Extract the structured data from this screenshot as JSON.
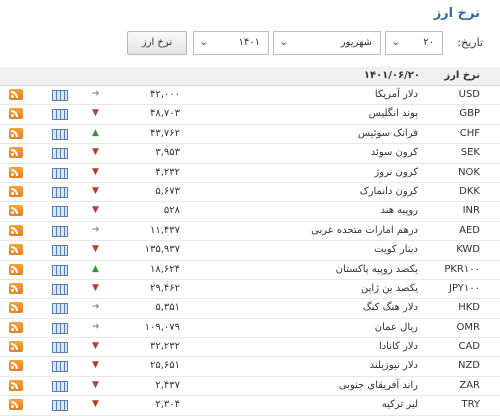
{
  "header": {
    "title": "نرخ ارز"
  },
  "filter": {
    "label": "تاریخ:",
    "day": "۲۰",
    "month": "شهریور",
    "year": "۱۴۰۱",
    "button": "نرخ ارز"
  },
  "table": {
    "col_name": "نرخ ارز",
    "date": "۱۴۰۱/۰۶/۲۰",
    "rows": [
      {
        "code": "USD",
        "name": "دلار آمریکا",
        "value": "۴۲,۰۰۰",
        "trend": "flat"
      },
      {
        "code": "GBP",
        "name": "پوند انگلیس",
        "value": "۴۸,۷۰۳",
        "trend": "down"
      },
      {
        "code": "CHF",
        "name": "فرانک سوئیس",
        "value": "۴۳,۷۶۲",
        "trend": "up"
      },
      {
        "code": "SEK",
        "name": "کرون سوئد",
        "value": "۳,۹۵۳",
        "trend": "down"
      },
      {
        "code": "NOK",
        "name": "کرون نروژ",
        "value": "۴,۲۳۲",
        "trend": "down"
      },
      {
        "code": "DKK",
        "name": "کرون دانمارک",
        "value": "۵,۶۷۳",
        "trend": "down"
      },
      {
        "code": "INR",
        "name": "روپیه هند",
        "value": "۵۲۸",
        "trend": "down"
      },
      {
        "code": "AED",
        "name": "درهم امارات متحده عربی",
        "value": "۱۱,۴۳۷",
        "trend": "flat"
      },
      {
        "code": "KWD",
        "name": "دینار کویت",
        "value": "۱۳۵,۹۳۷",
        "trend": "down"
      },
      {
        "code": "PKR۱۰۰",
        "name": "یکصد روپیه پاکستان",
        "value": "۱۸,۶۲۴",
        "trend": "up"
      },
      {
        "code": "JPY۱۰۰",
        "name": "یکصد ین ژاپن",
        "value": "۲۹,۴۶۲",
        "trend": "down"
      },
      {
        "code": "HKD",
        "name": "دلار هنگ کنگ",
        "value": "۵,۳۵۱",
        "trend": "flat"
      },
      {
        "code": "OMR",
        "name": "ریال عمان",
        "value": "۱۰۹,۰۷۹",
        "trend": "flat"
      },
      {
        "code": "CAD",
        "name": "دلار کانادا",
        "value": "۳۲,۲۳۲",
        "trend": "down"
      },
      {
        "code": "NZD",
        "name": "دلار نیوزیلند",
        "value": "۲۵,۶۵۱",
        "trend": "down"
      },
      {
        "code": "ZAR",
        "name": "راند آفریقای جنوبی",
        "value": "۲,۴۳۷",
        "trend": "down"
      },
      {
        "code": "TRY",
        "name": "لیر ترکیه",
        "value": "۲,۳۰۴",
        "trend": "down"
      }
    ]
  },
  "icons": {
    "chart": "chart-icon",
    "rss": "rss-icon",
    "arrow_up": "arrow-up-icon",
    "arrow_down": "arrow-down-icon",
    "arrow_flat": "arrow-right-icon"
  },
  "colors": {
    "title": "#2e6aa8",
    "up": "#2e9a2e",
    "down": "#c0392b",
    "flat": "#888888",
    "rss": "#e67e22"
  }
}
